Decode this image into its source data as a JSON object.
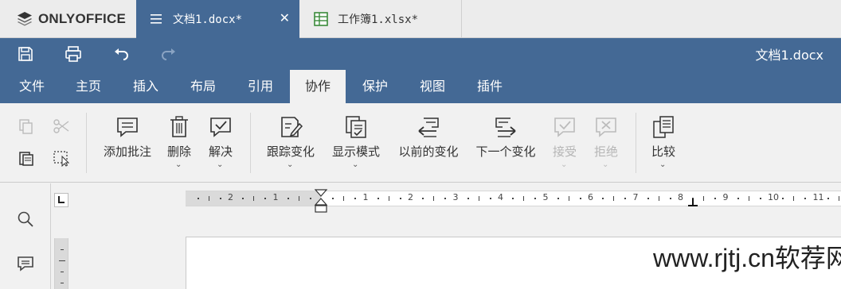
{
  "app": {
    "brand": "ONLYOFFICE"
  },
  "tabs": [
    {
      "label": "文档1.docx*",
      "type": "document",
      "active": true
    },
    {
      "label": "工作簿1.xlsx*",
      "type": "spreadsheet",
      "active": false
    }
  ],
  "header": {
    "title": "文档1.docx"
  },
  "menu": {
    "items": [
      "文件",
      "主页",
      "插入",
      "布局",
      "引用",
      "协作",
      "保护",
      "视图",
      "插件"
    ],
    "active": "协作"
  },
  "toolbar": {
    "add_comment": "添加批注",
    "delete": "删除",
    "resolve": "解决",
    "track_changes": "跟踪变化",
    "display_mode": "显示模式",
    "previous_change": "以前的变化",
    "next_change": "下一个变化",
    "accept": "接受",
    "reject": "拒绝",
    "compare": "比较"
  },
  "ruler": {
    "numbers": [
      "2",
      "1",
      "1",
      "2",
      "3",
      "4",
      "5",
      "6",
      "7",
      "8",
      "9",
      "10",
      "11"
    ]
  },
  "watermark": "www.rjtj.cn软荐网",
  "colors": {
    "header": "#446995",
    "toolbar": "#f1f1f1"
  }
}
